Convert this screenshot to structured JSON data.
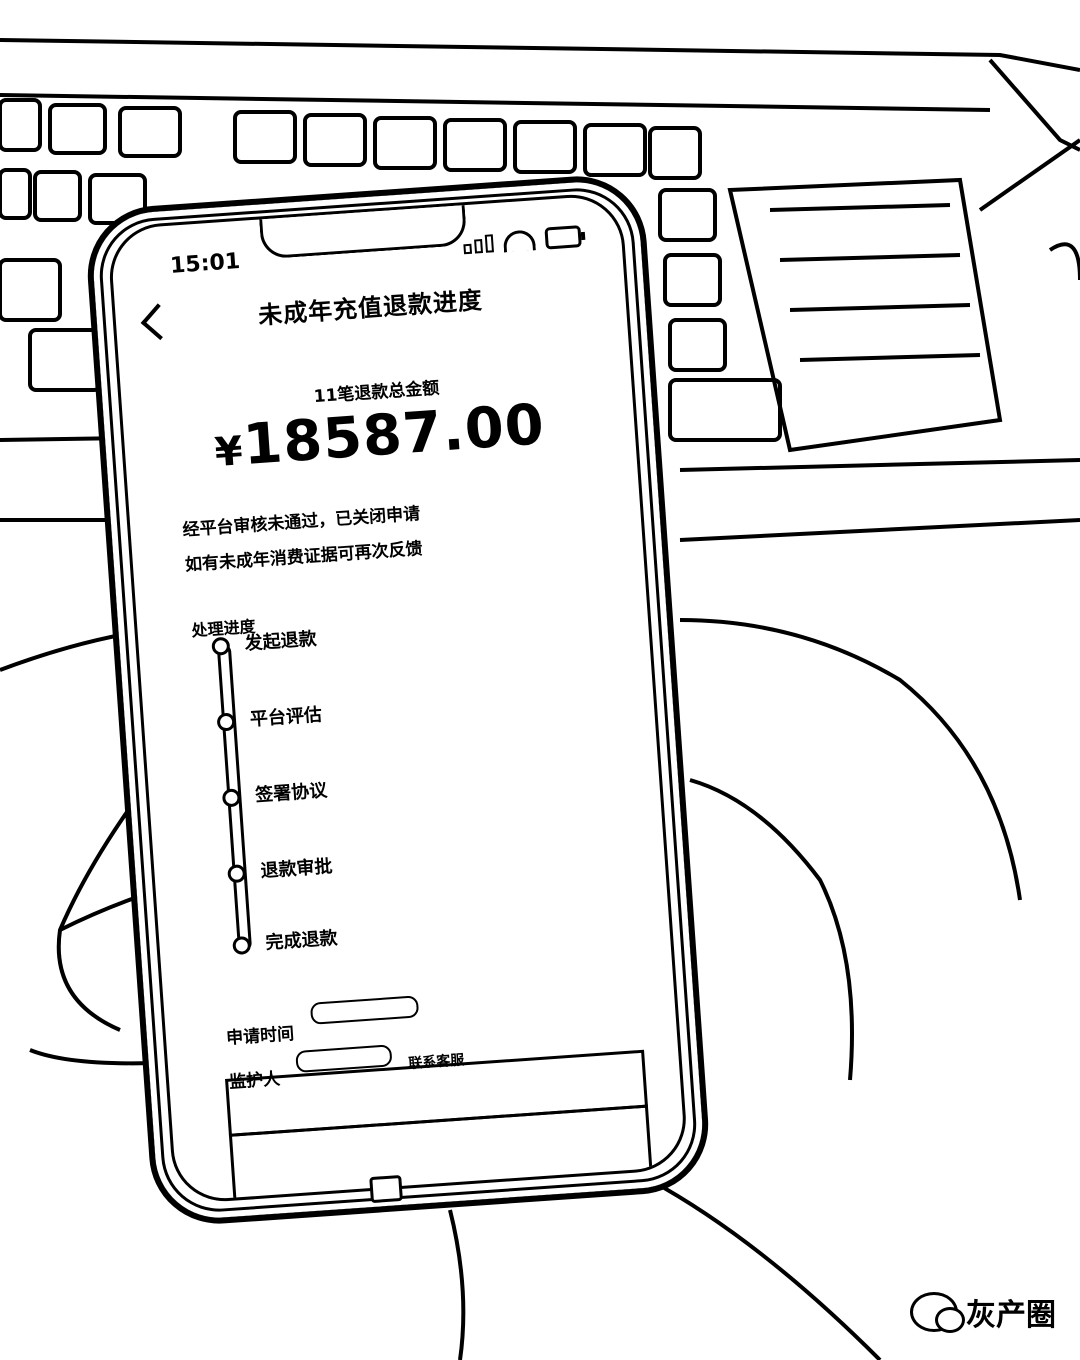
{
  "status_bar": {
    "time": "15:01"
  },
  "header": {
    "title": "未成年充值退款进度"
  },
  "summary": {
    "label": "11笔退款总金额",
    "currency": "¥",
    "amount": "18587.00"
  },
  "notices": [
    "经平台审核未通过，已关闭申请",
    "如有未成年消费证据可再次反馈"
  ],
  "progress": {
    "title": "处理进度",
    "steps": [
      "发起退款",
      "平台评估",
      "签署协议",
      "退款审批",
      "完成退款"
    ]
  },
  "details": {
    "apply_time_label": "申请时间",
    "guardian_label": "监护人"
  },
  "actions": {
    "contact_service": "联系客服"
  },
  "watermark": {
    "text": "灰产圈"
  }
}
